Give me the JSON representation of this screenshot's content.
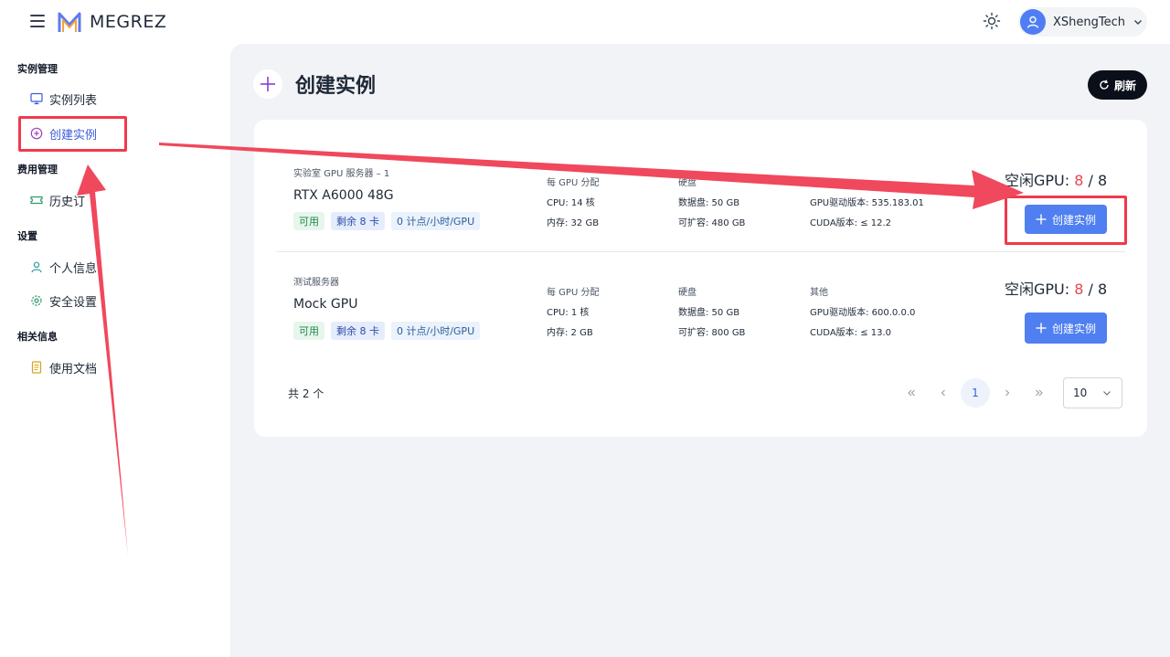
{
  "header": {
    "app_name": "MEGREZ",
    "user_name": "XShengTech"
  },
  "sidebar": {
    "groups": [
      {
        "title": "实例管理",
        "items": [
          {
            "label": "实例列表",
            "icon": "monitor-icon"
          },
          {
            "label": "创建实例",
            "icon": "plus-circle-icon",
            "active": true
          }
        ]
      },
      {
        "title": "费用管理",
        "items": [
          {
            "label": "历史订",
            "icon": "ticket-icon"
          }
        ]
      },
      {
        "title": "设置",
        "items": [
          {
            "label": "个人信息",
            "icon": "user-icon"
          },
          {
            "label": "安全设置",
            "icon": "gear-icon"
          }
        ]
      },
      {
        "title": "相关信息",
        "items": [
          {
            "label": "使用文档",
            "icon": "document-icon"
          }
        ]
      }
    ]
  },
  "page": {
    "title": "创建实例",
    "refresh_label": "刷新"
  },
  "servers": [
    {
      "server_label": "实验室 GPU 服务器 – 1",
      "gpu_name": "RTX A6000 48G",
      "tags": [
        "可用",
        "剩余 8 卡",
        "0 计点/小时/GPU"
      ],
      "alloc_header": "每 GPU 分配",
      "cpu": "CPU: 14 核",
      "mem": "内存: 32 GB",
      "disk_header": "硬盘",
      "data_disk": "数据盘: 50 GB",
      "expandable": "可扩容: 480 GB",
      "other_header": "",
      "driver": "GPU驱动版本: 535.183.01",
      "cuda": "CUDA版本: ≤ 12.2",
      "idle_label": "空闲GPU:",
      "idle_free": "8",
      "idle_total": "/ 8",
      "create_label": "创建实例"
    },
    {
      "server_label": "测试服务器",
      "gpu_name": "Mock GPU",
      "tags": [
        "可用",
        "剩余 8 卡",
        "0 计点/小时/GPU"
      ],
      "alloc_header": "每 GPU 分配",
      "cpu": "CPU: 1 核",
      "mem": "内存: 2 GB",
      "disk_header": "硬盘",
      "data_disk": "数据盘: 50 GB",
      "expandable": "可扩容: 800 GB",
      "other_header": "其他",
      "driver": "GPU驱动版本: 600.0.0.0",
      "cuda": "CUDA版本: ≤ 13.0",
      "idle_label": "空闲GPU:",
      "idle_free": "8",
      "idle_total": "/ 8",
      "create_label": "创建实例"
    }
  ],
  "pagination": {
    "total": "共 2 个",
    "current_page": "1",
    "page_size": "10"
  },
  "colors": {
    "accent": "#4f7ff0",
    "annotation": "#f0394c",
    "idle_free": "#e5484d"
  }
}
